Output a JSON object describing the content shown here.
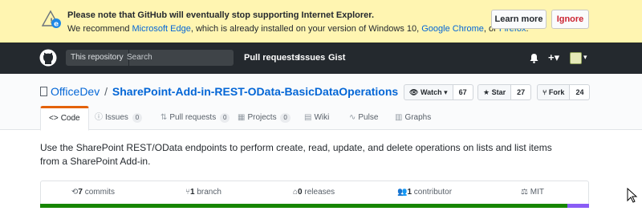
{
  "banner": {
    "line1": "Please note that GitHub will eventually stop supporting Internet Explorer.",
    "line2_pre": "We recommend ",
    "edge_link": "Microsoft Edge",
    "line2_mid": ", which is already installed on your version of Windows 10, ",
    "chrome_link": "Google Chrome",
    "line2_or": ", or ",
    "firefox_link": "Firefox",
    "line2_end": ".",
    "learn_more": "Learn more",
    "ignore": "Ignore"
  },
  "header": {
    "search_scope": "This repository",
    "search_placeholder": "Search",
    "nav": [
      "Pull requests",
      "Issues",
      "Gist"
    ],
    "bell": "🔔",
    "plus": "+▾",
    "avatar_caret": "▾"
  },
  "repo": {
    "owner": "OfficeDev",
    "separator": "/",
    "name": "SharePoint-Add-in-REST-OData-BasicDataOperations",
    "watch_label": "Watch ▾",
    "watch_count": "67",
    "star_label": "Star",
    "star_count": "27",
    "fork_label": "Fork",
    "fork_count": "24"
  },
  "tabs": [
    {
      "icon": "<>",
      "label": "Code",
      "count": ""
    },
    {
      "icon": "ⓘ",
      "label": "Issues",
      "count": "0"
    },
    {
      "icon": "⇅",
      "label": "Pull requests",
      "count": "0"
    },
    {
      "icon": "▦",
      "label": "Projects",
      "count": "0"
    },
    {
      "icon": "▤",
      "label": "Wiki",
      "count": ""
    },
    {
      "icon": "∿",
      "label": "Pulse",
      "count": ""
    },
    {
      "icon": "▥",
      "label": "Graphs",
      "count": ""
    }
  ],
  "description": "Use the SharePoint REST/OData endpoints to perform create, read, update, and delete operations on lists and list items from a SharePoint Add-in.",
  "summary": {
    "commits_num": "7",
    "commits_label": " commits",
    "branch_num": "1",
    "branch_label": " branch",
    "releases_num": "0",
    "releases_label": " releases",
    "contributor_num": "1",
    "contributor_label": " contributor",
    "license": "MIT"
  },
  "languages": [
    {
      "color": "#178600",
      "share": 0.96
    },
    {
      "color": "#8a5cf5",
      "share": 0.04
    }
  ],
  "colors": {
    "banner_bg": "#fff5b1",
    "header_bg": "#24292e",
    "link": "#0366d6",
    "tab_accent": "#e36209"
  }
}
